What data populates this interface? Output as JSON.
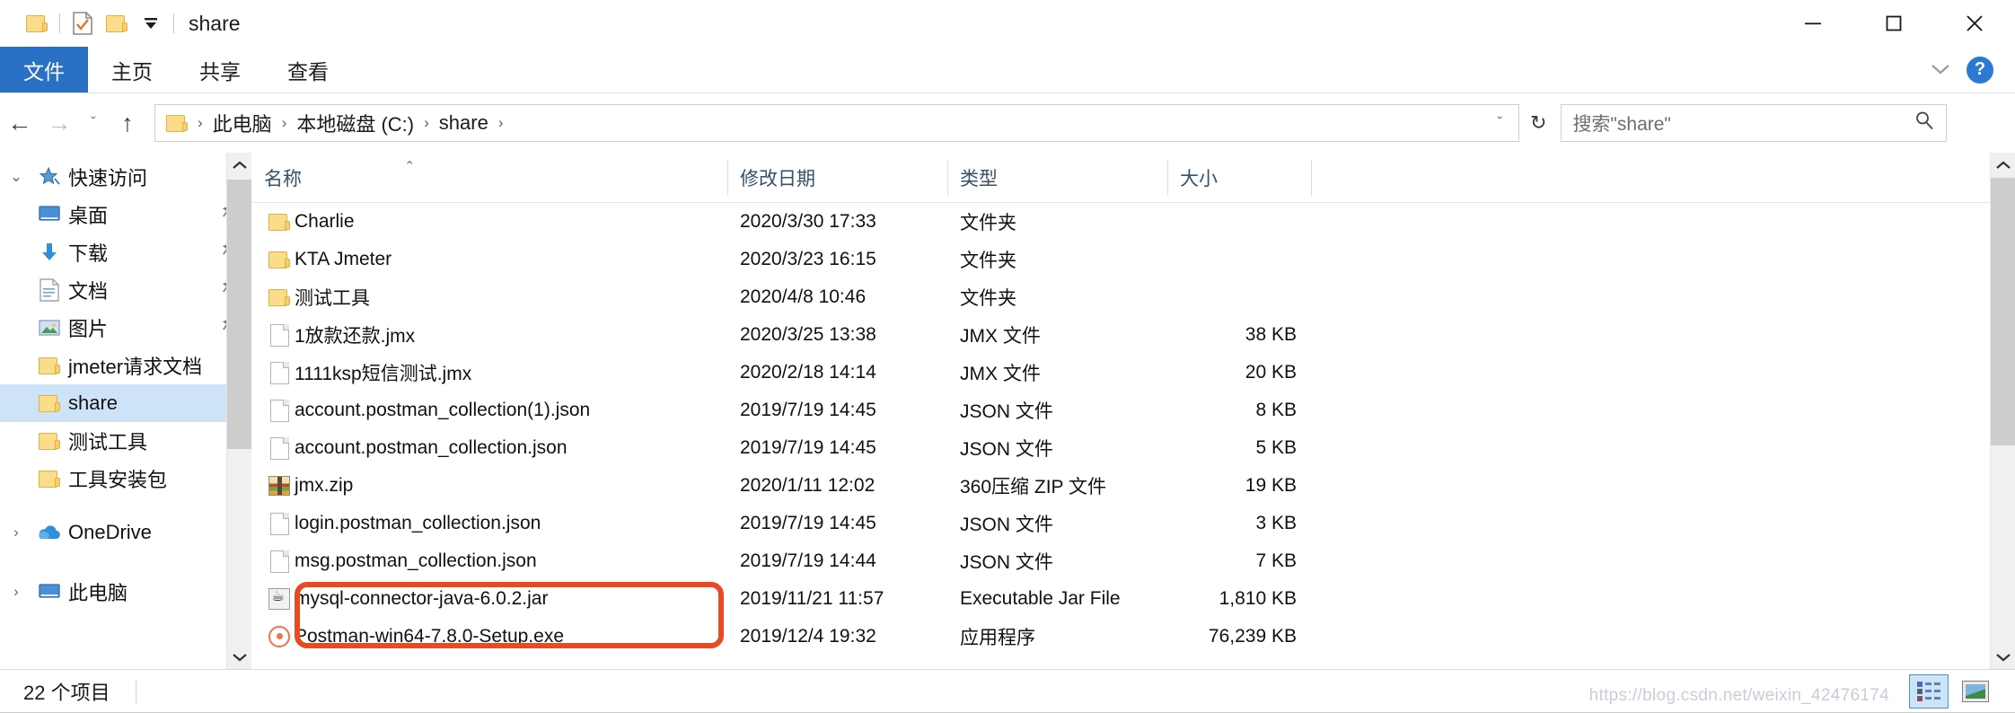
{
  "window": {
    "title": "share",
    "quick_access": [
      {
        "name": "folder-icon",
        "label": "文件夹"
      },
      {
        "name": "properties-icon",
        "label": "属性"
      },
      {
        "name": "new-folder-icon",
        "label": "新建文件夹"
      }
    ],
    "controls": {
      "minimize": "─",
      "maximize": "□",
      "close": "✕"
    }
  },
  "ribbon": {
    "tabs": [
      {
        "label": "文件",
        "active": true
      },
      {
        "label": "主页",
        "active": false
      },
      {
        "label": "共享",
        "active": false
      },
      {
        "label": "查看",
        "active": false
      }
    ],
    "expand_icon": "ˇ",
    "help_label": "?"
  },
  "address": {
    "back": "←",
    "forward": "→",
    "recent": "ˇ",
    "up": "↑",
    "breadcrumbs": [
      "此电脑",
      "本地磁盘 (C:)",
      "share"
    ],
    "separator": "›",
    "dropdown": "ˇ",
    "refresh": "↻"
  },
  "search": {
    "placeholder": "搜索\"share\"",
    "icon": "⚲"
  },
  "sidebar": {
    "groups": [
      {
        "name": "quick-access",
        "label": "快速访问",
        "expander": "⌄",
        "icon": "pin-star-icon",
        "items": [
          {
            "label": "桌面",
            "icon": "desktop-icon",
            "pinned": true,
            "selected": false
          },
          {
            "label": "下载",
            "icon": "download-icon",
            "pinned": true,
            "selected": false
          },
          {
            "label": "文档",
            "icon": "documents-icon",
            "pinned": true,
            "selected": false
          },
          {
            "label": "图片",
            "icon": "pictures-icon",
            "pinned": true,
            "selected": false
          },
          {
            "label": "jmeter请求文档",
            "icon": "folder-icon",
            "pinned": false,
            "selected": false
          },
          {
            "label": "share",
            "icon": "folder-icon",
            "pinned": false,
            "selected": true
          },
          {
            "label": "测试工具",
            "icon": "folder-icon",
            "pinned": false,
            "selected": false
          },
          {
            "label": "工具安装包",
            "icon": "folder-icon",
            "pinned": false,
            "selected": false
          }
        ]
      },
      {
        "name": "onedrive",
        "label": "OneDrive",
        "expander": "›",
        "icon": "cloud-icon",
        "items": []
      },
      {
        "name": "this-pc",
        "label": "此电脑",
        "expander": "›",
        "icon": "pc-icon",
        "items": []
      }
    ]
  },
  "file_list": {
    "columns": [
      {
        "key": "name",
        "label": "名称",
        "sorted": "asc",
        "sort_glyph": "⌃"
      },
      {
        "key": "date",
        "label": "修改日期"
      },
      {
        "key": "type",
        "label": "类型"
      },
      {
        "key": "size",
        "label": "大小"
      }
    ],
    "rows": [
      {
        "name": "Charlie",
        "date": "2020/3/30 17:33",
        "type": "文件夹",
        "size": "",
        "icon": "folder-icon"
      },
      {
        "name": "KTA Jmeter",
        "date": "2020/3/23 16:15",
        "type": "文件夹",
        "size": "",
        "icon": "folder-icon"
      },
      {
        "name": "测试工具",
        "date": "2020/4/8 10:46",
        "type": "文件夹",
        "size": "",
        "icon": "folder-icon"
      },
      {
        "name": "1放款还款.jmx",
        "date": "2020/3/25 13:38",
        "type": "JMX 文件",
        "size": "38 KB",
        "icon": "document-icon"
      },
      {
        "name": "1111ksp短信测试.jmx",
        "date": "2020/2/18 14:14",
        "type": "JMX 文件",
        "size": "20 KB",
        "icon": "document-icon"
      },
      {
        "name": "account.postman_collection(1).json",
        "date": "2019/7/19 14:45",
        "type": "JSON 文件",
        "size": "8 KB",
        "icon": "document-icon"
      },
      {
        "name": "account.postman_collection.json",
        "date": "2019/7/19 14:45",
        "type": "JSON 文件",
        "size": "5 KB",
        "icon": "document-icon"
      },
      {
        "name": "jmx.zip",
        "date": "2020/1/11 12:02",
        "type": "360压缩 ZIP 文件",
        "size": "19 KB",
        "icon": "zip-icon"
      },
      {
        "name": "login.postman_collection.json",
        "date": "2019/7/19 14:45",
        "type": "JSON 文件",
        "size": "3 KB",
        "icon": "document-icon"
      },
      {
        "name": "msg.postman_collection.json",
        "date": "2019/7/19 14:44",
        "type": "JSON 文件",
        "size": "7 KB",
        "icon": "document-icon"
      },
      {
        "name": "mysql-connector-java-6.0.2.jar",
        "date": "2019/11/21 11:57",
        "type": "Executable Jar File",
        "size": "1,810 KB",
        "icon": "jar-icon"
      },
      {
        "name": "Postman-win64-7.8.0-Setup.exe",
        "date": "2019/12/4 19:32",
        "type": "应用程序",
        "size": "76,239 KB",
        "icon": "exe-icon"
      }
    ]
  },
  "status": {
    "item_count": "22 个项目",
    "views": [
      {
        "name": "details-view",
        "active": true
      },
      {
        "name": "large-icons-view",
        "active": false
      }
    ]
  },
  "annotation": {
    "target_row": "mysql-connector-java-6.0.2.jar",
    "color": "#ea4a22"
  },
  "watermark": {
    "text": "https://blog.csdn.net/weixin_42476174"
  }
}
